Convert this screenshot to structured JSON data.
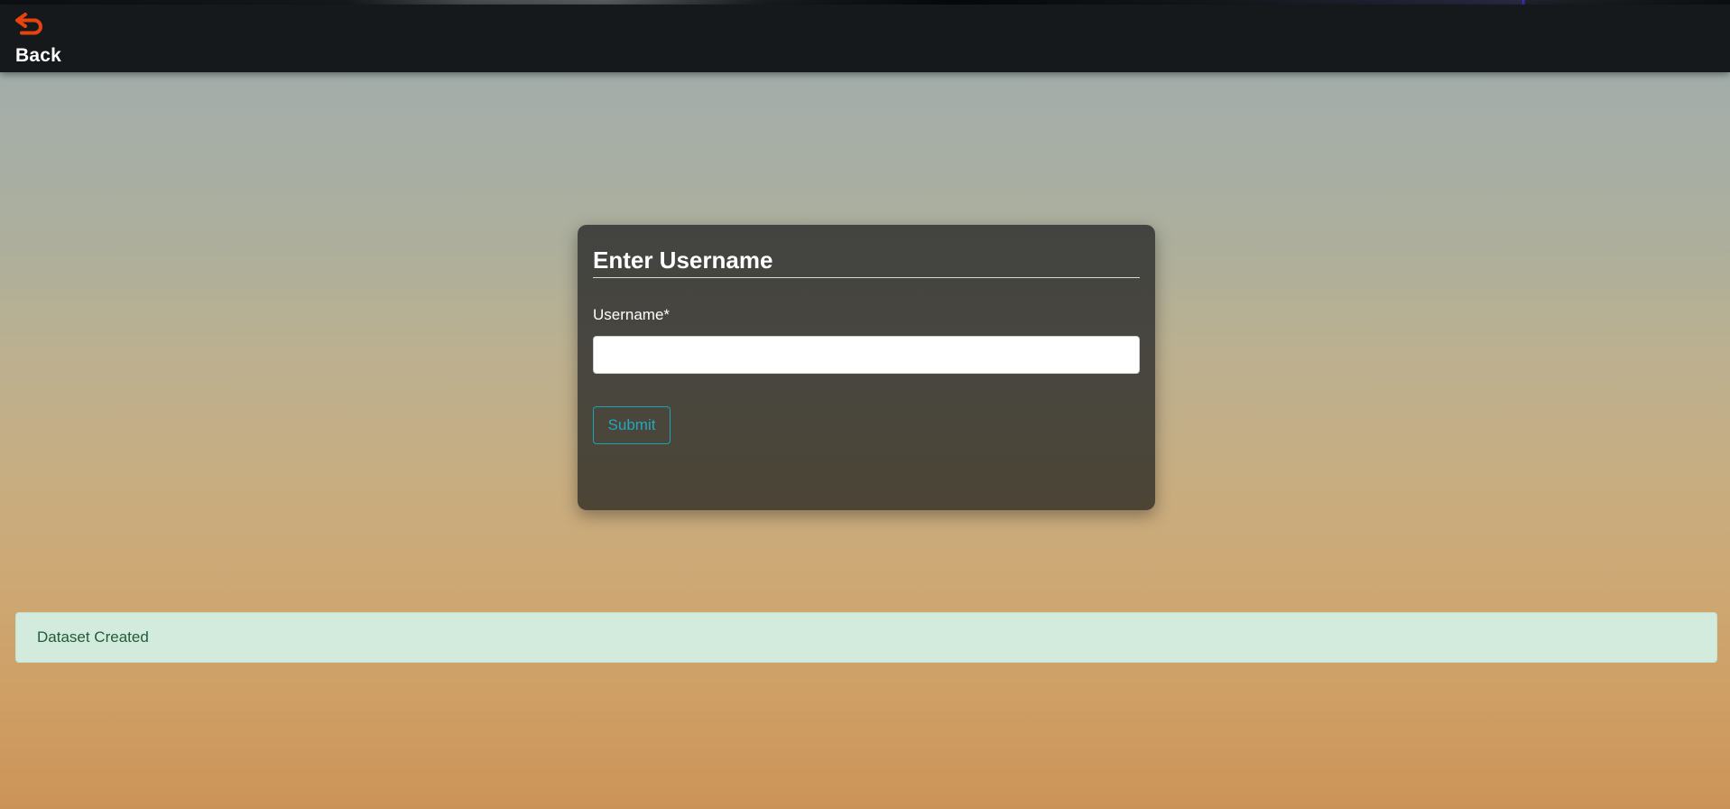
{
  "navbar": {
    "back_label": "Back",
    "back_icon": "undo-arrow-icon",
    "accent_color": "#e8430f"
  },
  "form": {
    "title": "Enter Username",
    "username_label": "Username*",
    "username_value": "",
    "username_placeholder": "",
    "submit_label": "Submit",
    "submit_color": "#1aa3b8"
  },
  "alert": {
    "message": "Dataset Created",
    "color": "#d2ebdc"
  }
}
